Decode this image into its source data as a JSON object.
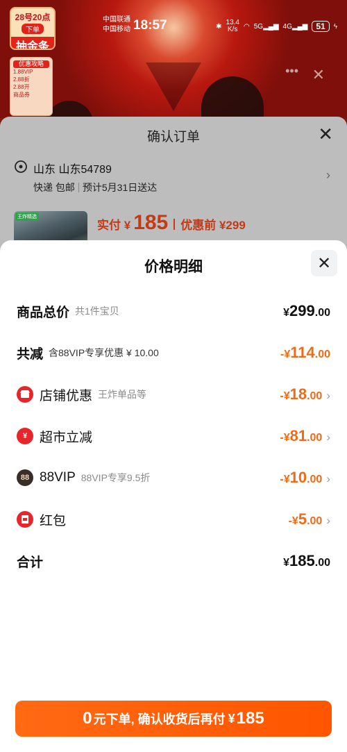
{
  "status_bar": {
    "carrier_1": "中国联通",
    "carrier_2": "中国移动",
    "time": "18:57",
    "net_speed": "13.4",
    "net_unit": "K/s",
    "signal_1": "5G",
    "signal_2": "4G",
    "battery": "51"
  },
  "promo": {
    "badge_line1": "28号20点",
    "badge_line2": "下单",
    "badge_line3": "抽金条",
    "side_title": "优惠攻略",
    "side_line1": "1.88VIP",
    "side_line2": "2.88折",
    "side_line3": "2.88开",
    "side_line4": "商品券"
  },
  "order": {
    "title": "确认订单",
    "address_name": "山东 山东54789",
    "delivery": "快递 包邮",
    "eta": "预计5月31日送达",
    "product_tag": "王炸精选",
    "paid_label": "实付 ¥",
    "paid_amount": "185",
    "before_discount": "优惠前 ¥299"
  },
  "price_detail": {
    "title": "价格明细",
    "rows": [
      {
        "label": "商品总价",
        "sub": "共1件宝贝",
        "currency": "¥",
        "int": "299",
        "dec": ".00"
      },
      {
        "label": "共减",
        "sub": "含88VIP专享优惠 ¥ 10.00",
        "currency": "-¥",
        "int": "114",
        "dec": ".00"
      },
      {
        "label": "店铺优惠",
        "sub": "王炸单品等",
        "currency": "-¥",
        "int": "18",
        "dec": ".00",
        "icon": "shop-icon"
      },
      {
        "label": "超市立减",
        "sub": "",
        "currency": "-¥",
        "int": "81",
        "dec": ".00",
        "icon": "yuan-icon"
      },
      {
        "label": "88VIP",
        "sub": "88VIP专享9.5折",
        "currency": "-¥",
        "int": "10",
        "dec": ".00",
        "icon": "vip-88-icon",
        "icon_text": "88"
      },
      {
        "label": "红包",
        "sub": "",
        "currency": "-¥",
        "int": "5",
        "dec": ".00",
        "icon": "red-envelope-icon"
      },
      {
        "label": "合计",
        "sub": "",
        "currency": "¥",
        "int": "185",
        "dec": ".00"
      }
    ]
  },
  "cta": {
    "zero": "0",
    "text": "元下单, 确认收货后再付",
    "currency": "¥",
    "amount": "185"
  },
  "colors": {
    "accent_orange": "#f26a14",
    "cta_orange": "#ff5a0a",
    "icon_red": "#e8252b"
  }
}
